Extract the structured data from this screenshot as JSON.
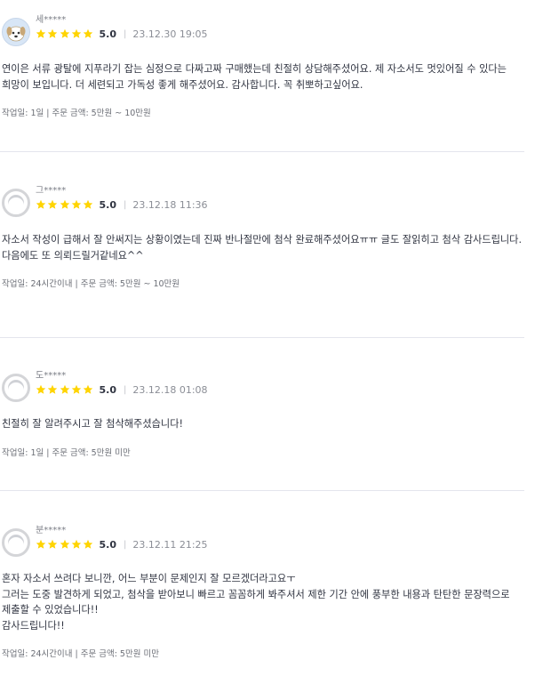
{
  "reviews": [
    {
      "nickname": "세*****",
      "avatar": "photo",
      "score": "5.0",
      "date": "23.12.30 19:05",
      "content": "연이은 서류 광탈에 지푸라기 잡는 심정으로 다짜고짜 구매했는데 친절히 상담해주셨어요. 제 자소서도 멋있어질 수 있다는 희망이 보입니다. 더 세련되고 가독성 좋게 해주셨어요. 감사합니다. 꼭 취뽀하고싶어요.",
      "meta": "작업일: 1일 | 주문 금액: 5만원 ~ 10만원"
    },
    {
      "nickname": "그*****",
      "avatar": "default",
      "score": "5.0",
      "date": "23.12.18 11:36",
      "content": "자소서 작성이 급해서 잘 안써지는 상황이였는데  진짜 반나절만에 첨삭 완료해주셨어요ㅠㅠ 글도 잘읽히고 첨삭 감사드립니다.\n다음에도 또 의뢰드릴거같네요^^",
      "meta": "작업일: 24시간이내 | 주문 금액: 5만원 ~ 10만원"
    },
    {
      "nickname": "도*****",
      "avatar": "default",
      "score": "5.0",
      "date": "23.12.18 01:08",
      "content": "친절히 잘 알려주시고 잘 첨삭해주셨습니다!",
      "meta": "작업일: 1일 | 주문 금액: 5만원 미만"
    },
    {
      "nickname": "분*****",
      "avatar": "default",
      "score": "5.0",
      "date": "23.12.11 21:25",
      "content": "혼자 자소서 쓰려다 보니깐, 어느 부분이 문제인지 잘 모르겠더라고요ㅜ\n그러는 도중 발견하게 되었고, 첨삭을 받아보니 빠르고 꼼꼼하게 봐주셔서 제한 기간 안에 풍부한 내용과 탄탄한 문장력으로 제출할 수 있었습니다!!\n감사드립니다!!",
      "meta": "작업일: 24시간이내 | 주문 금액: 5만원 미만"
    }
  ],
  "star_rating": [
    5,
    5,
    5,
    5
  ],
  "colors": {
    "star": "#ffd400",
    "divider": "#e4e5ed",
    "text": "#303441",
    "muted": "#7b7e86"
  }
}
